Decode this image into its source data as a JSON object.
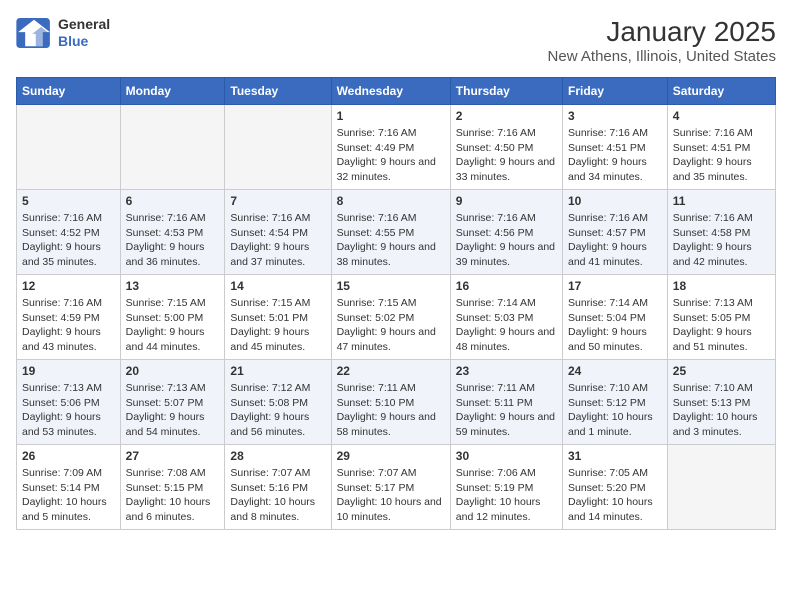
{
  "header": {
    "logo_line1": "General",
    "logo_line2": "Blue",
    "title": "January 2025",
    "subtitle": "New Athens, Illinois, United States"
  },
  "days_of_week": [
    "Sunday",
    "Monday",
    "Tuesday",
    "Wednesday",
    "Thursday",
    "Friday",
    "Saturday"
  ],
  "weeks": [
    [
      {
        "day": "",
        "info": ""
      },
      {
        "day": "",
        "info": ""
      },
      {
        "day": "",
        "info": ""
      },
      {
        "day": "1",
        "info": "Sunrise: 7:16 AM\nSunset: 4:49 PM\nDaylight: 9 hours and 32 minutes."
      },
      {
        "day": "2",
        "info": "Sunrise: 7:16 AM\nSunset: 4:50 PM\nDaylight: 9 hours and 33 minutes."
      },
      {
        "day": "3",
        "info": "Sunrise: 7:16 AM\nSunset: 4:51 PM\nDaylight: 9 hours and 34 minutes."
      },
      {
        "day": "4",
        "info": "Sunrise: 7:16 AM\nSunset: 4:51 PM\nDaylight: 9 hours and 35 minutes."
      }
    ],
    [
      {
        "day": "5",
        "info": "Sunrise: 7:16 AM\nSunset: 4:52 PM\nDaylight: 9 hours and 35 minutes."
      },
      {
        "day": "6",
        "info": "Sunrise: 7:16 AM\nSunset: 4:53 PM\nDaylight: 9 hours and 36 minutes."
      },
      {
        "day": "7",
        "info": "Sunrise: 7:16 AM\nSunset: 4:54 PM\nDaylight: 9 hours and 37 minutes."
      },
      {
        "day": "8",
        "info": "Sunrise: 7:16 AM\nSunset: 4:55 PM\nDaylight: 9 hours and 38 minutes."
      },
      {
        "day": "9",
        "info": "Sunrise: 7:16 AM\nSunset: 4:56 PM\nDaylight: 9 hours and 39 minutes."
      },
      {
        "day": "10",
        "info": "Sunrise: 7:16 AM\nSunset: 4:57 PM\nDaylight: 9 hours and 41 minutes."
      },
      {
        "day": "11",
        "info": "Sunrise: 7:16 AM\nSunset: 4:58 PM\nDaylight: 9 hours and 42 minutes."
      }
    ],
    [
      {
        "day": "12",
        "info": "Sunrise: 7:16 AM\nSunset: 4:59 PM\nDaylight: 9 hours and 43 minutes."
      },
      {
        "day": "13",
        "info": "Sunrise: 7:15 AM\nSunset: 5:00 PM\nDaylight: 9 hours and 44 minutes."
      },
      {
        "day": "14",
        "info": "Sunrise: 7:15 AM\nSunset: 5:01 PM\nDaylight: 9 hours and 45 minutes."
      },
      {
        "day": "15",
        "info": "Sunrise: 7:15 AM\nSunset: 5:02 PM\nDaylight: 9 hours and 47 minutes."
      },
      {
        "day": "16",
        "info": "Sunrise: 7:14 AM\nSunset: 5:03 PM\nDaylight: 9 hours and 48 minutes."
      },
      {
        "day": "17",
        "info": "Sunrise: 7:14 AM\nSunset: 5:04 PM\nDaylight: 9 hours and 50 minutes."
      },
      {
        "day": "18",
        "info": "Sunrise: 7:13 AM\nSunset: 5:05 PM\nDaylight: 9 hours and 51 minutes."
      }
    ],
    [
      {
        "day": "19",
        "info": "Sunrise: 7:13 AM\nSunset: 5:06 PM\nDaylight: 9 hours and 53 minutes."
      },
      {
        "day": "20",
        "info": "Sunrise: 7:13 AM\nSunset: 5:07 PM\nDaylight: 9 hours and 54 minutes."
      },
      {
        "day": "21",
        "info": "Sunrise: 7:12 AM\nSunset: 5:08 PM\nDaylight: 9 hours and 56 minutes."
      },
      {
        "day": "22",
        "info": "Sunrise: 7:11 AM\nSunset: 5:10 PM\nDaylight: 9 hours and 58 minutes."
      },
      {
        "day": "23",
        "info": "Sunrise: 7:11 AM\nSunset: 5:11 PM\nDaylight: 9 hours and 59 minutes."
      },
      {
        "day": "24",
        "info": "Sunrise: 7:10 AM\nSunset: 5:12 PM\nDaylight: 10 hours and 1 minute."
      },
      {
        "day": "25",
        "info": "Sunrise: 7:10 AM\nSunset: 5:13 PM\nDaylight: 10 hours and 3 minutes."
      }
    ],
    [
      {
        "day": "26",
        "info": "Sunrise: 7:09 AM\nSunset: 5:14 PM\nDaylight: 10 hours and 5 minutes."
      },
      {
        "day": "27",
        "info": "Sunrise: 7:08 AM\nSunset: 5:15 PM\nDaylight: 10 hours and 6 minutes."
      },
      {
        "day": "28",
        "info": "Sunrise: 7:07 AM\nSunset: 5:16 PM\nDaylight: 10 hours and 8 minutes."
      },
      {
        "day": "29",
        "info": "Sunrise: 7:07 AM\nSunset: 5:17 PM\nDaylight: 10 hours and 10 minutes."
      },
      {
        "day": "30",
        "info": "Sunrise: 7:06 AM\nSunset: 5:19 PM\nDaylight: 10 hours and 12 minutes."
      },
      {
        "day": "31",
        "info": "Sunrise: 7:05 AM\nSunset: 5:20 PM\nDaylight: 10 hours and 14 minutes."
      },
      {
        "day": "",
        "info": ""
      }
    ]
  ]
}
